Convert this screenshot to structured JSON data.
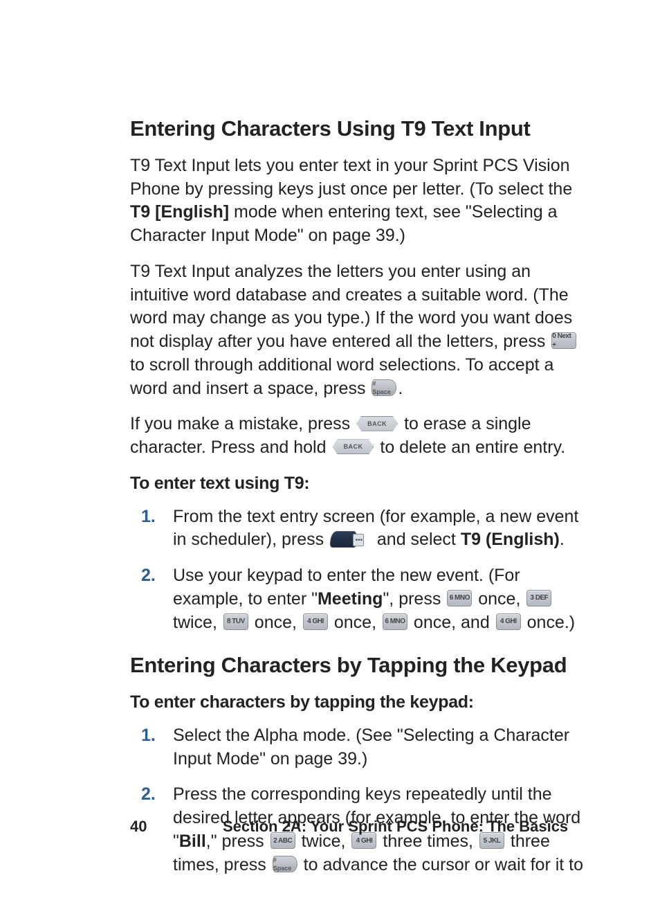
{
  "heading1": "Entering Characters Using T9 Text Input",
  "p1_a": "T9 Text Input lets you enter text in your Sprint PCS Vision Phone by pressing keys just once per letter. (To select the ",
  "p1_bold": "T9 [English]",
  "p1_b": " mode when entering text, see \"Selecting a Character Input Mode\" on page 39.)",
  "p2_a": "T9 Text Input analyzes the letters you enter using an intuitive word database and creates a suitable word. (The word may change as you type.) If the word you want does not display after you have entered all the letters, press ",
  "p2_b": " to scroll through additional word selections. To accept a word and insert a space, press ",
  "p2_c": ".",
  "p3_a": "If you make a mistake, press ",
  "p3_b": " to erase a single character. Press and hold ",
  "p3_c": " to delete an entire entry.",
  "sub1": "To enter text using T9:",
  "step1_a": "From the text entry screen (for example, a new event in scheduler), press ",
  "step1_b": " and select ",
  "step1_bold": "T9 (English)",
  "step1_c": ".",
  "step2_a": "Use your keypad to enter the new event. (For example, to enter \"",
  "step2_bold": "Meeting",
  "step2_b": "\", press ",
  "step2_c": " once, ",
  "step2_d": " twice, ",
  "step2_e": " once, ",
  "step2_f": " once, ",
  "step2_g": " once, and ",
  "step2_h": " once.)",
  "heading2": "Entering Characters by Tapping the Keypad",
  "sub2": "To enter characters by tapping the keypad:",
  "step3": "Select the Alpha mode. (See \"Selecting a Character Input Mode\" on page 39.)",
  "step4_a": "Press the corresponding keys repeatedly until the desired letter appears (for example, to enter the word \"",
  "step4_bold": "Bill",
  "step4_b": ",\" press ",
  "step4_c": " twice, ",
  "step4_d": " three times, ",
  "step4_e": " three times, press ",
  "step4_f": " to advance the cursor or wait for it to",
  "keys": {
    "zero": "0 Next +",
    "hash": "# Space",
    "back": "BACK",
    "two": "2 ABC",
    "three": "3 DEF",
    "four": "4 GHI",
    "five": "5 JKL",
    "six": "6 MNO",
    "eight": "8 TUV"
  },
  "footer_page": "40",
  "footer_section": "Section 2A: Your Sprint PCS Phone: The Basics"
}
